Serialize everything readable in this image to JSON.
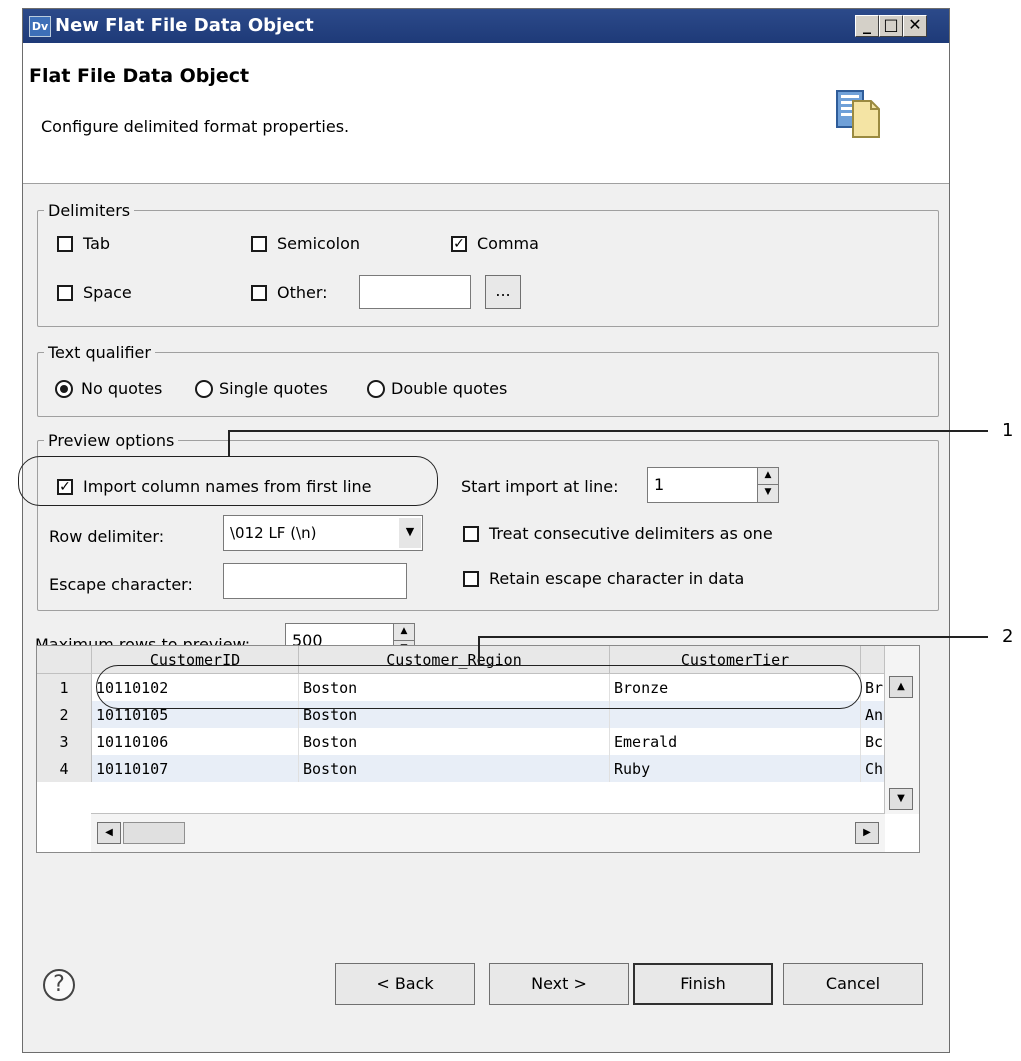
{
  "window": {
    "title": "New Flat File Data Object",
    "app_icon": "Dv"
  },
  "header": {
    "title": "Flat File Data Object",
    "subtitle": "Configure delimited format properties."
  },
  "delimiters": {
    "legend": "Delimiters",
    "tab": {
      "label": "Tab",
      "checked": false
    },
    "semicolon": {
      "label": "Semicolon",
      "checked": false
    },
    "comma": {
      "label": "Comma",
      "checked": true
    },
    "space": {
      "label": "Space",
      "checked": false
    },
    "other": {
      "label": "Other:",
      "checked": false,
      "value": ""
    },
    "browse_label": "..."
  },
  "text_qualifier": {
    "legend": "Text qualifier",
    "options": [
      "No quotes",
      "Single quotes",
      "Double quotes"
    ],
    "selected": "No quotes"
  },
  "preview_options": {
    "legend": "Preview options",
    "import_col_names": {
      "label": "Import column names from first line",
      "checked": true
    },
    "start_import_label": "Start import at line:",
    "start_import_value": "1",
    "row_delimiter_label": "Row delimiter:",
    "row_delimiter_value": "\\012 LF (\\n)",
    "treat_consecutive": {
      "label": "Treat consecutive delimiters as one",
      "checked": false
    },
    "escape_char_label": "Escape character:",
    "escape_char_value": "",
    "retain_escape": {
      "label": "Retain escape character in data",
      "checked": false
    }
  },
  "max_rows": {
    "label": "Maximum rows to preview:",
    "value": "500"
  },
  "preview_table": {
    "columns": [
      "CustomerID",
      "Customer_Region",
      "CustomerTier"
    ],
    "rows": [
      {
        "n": "1",
        "cells": [
          "10110102",
          "Boston",
          "Bronze",
          "Br"
        ]
      },
      {
        "n": "2",
        "cells": [
          "10110105",
          "Boston",
          "",
          "An"
        ]
      },
      {
        "n": "3",
        "cells": [
          "10110106",
          "Boston",
          "Emerald",
          "Bc"
        ]
      },
      {
        "n": "4",
        "cells": [
          "10110107",
          "Boston",
          "Ruby",
          "Ch"
        ]
      }
    ]
  },
  "callouts": [
    "1",
    "2"
  ],
  "footer": {
    "help_label": "?",
    "back_label": "< Back",
    "next_label": "Next >",
    "finish_label": "Finish",
    "cancel_label": "Cancel"
  }
}
